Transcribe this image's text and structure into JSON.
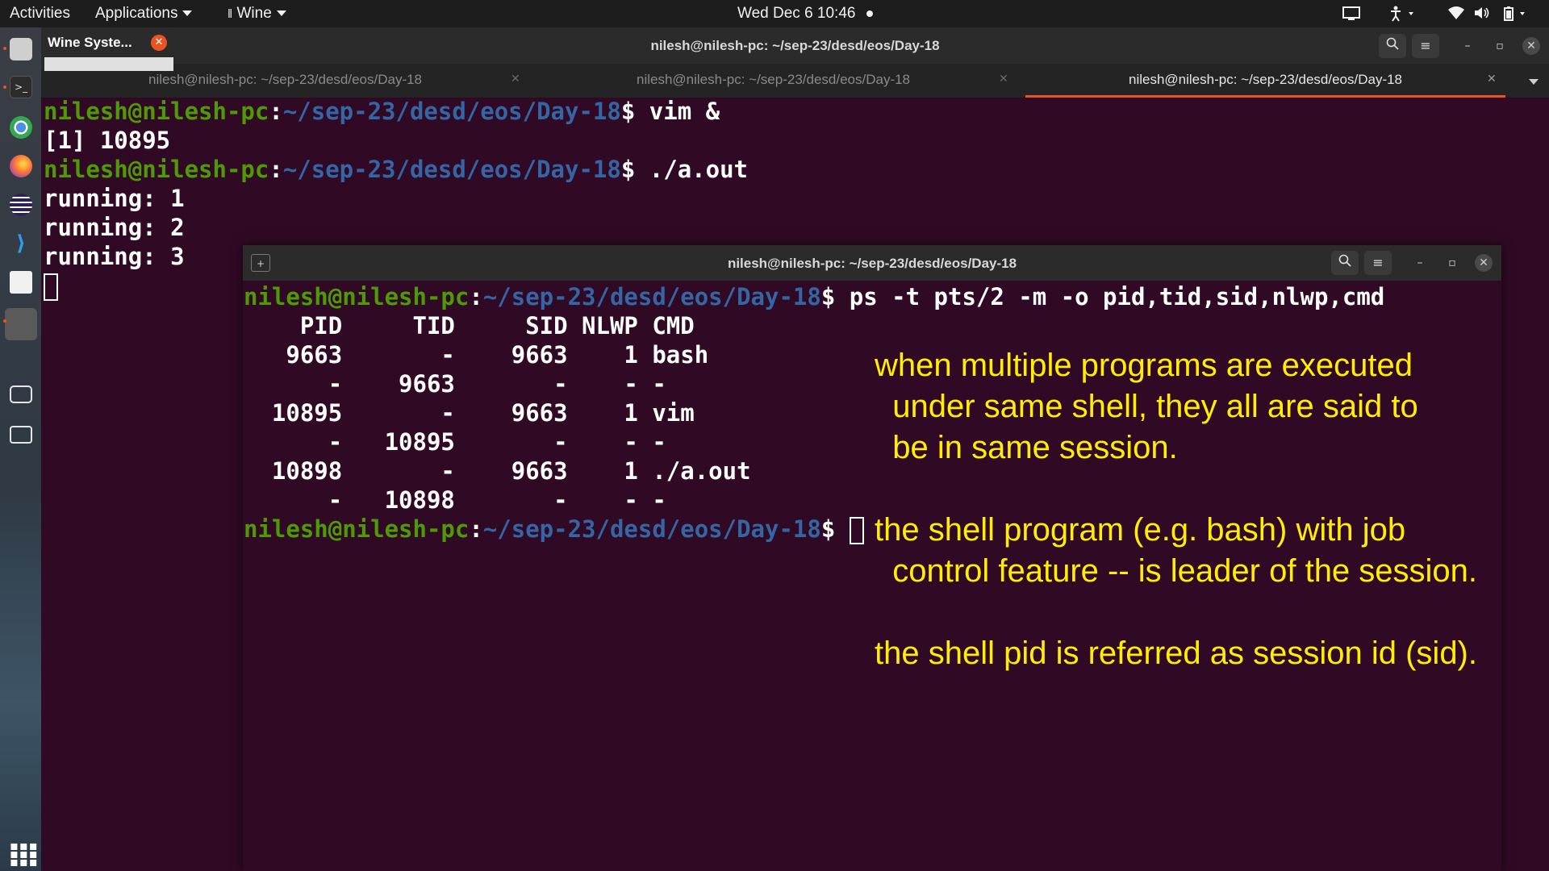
{
  "topbar": {
    "activities": "Activities",
    "applications": "Applications",
    "wine": "Wine",
    "clock": "Wed Dec 6  10:46"
  },
  "dock": {
    "icons": [
      "files-icon",
      "terminal-icon",
      "chrome-icon",
      "firefox-icon",
      "eclipse-icon",
      "vscode-icon",
      "document-viewer-icon",
      "wine-icon",
      "display-icon",
      "screenshot-icon",
      "app-grid-icon"
    ]
  },
  "wine_popup": {
    "label": "Wine Syste..."
  },
  "main_window": {
    "title": "nilesh@nilesh-pc: ~/sep-23/desd/eos/Day-18",
    "tabs": [
      "nilesh@nilesh-pc: ~/sep-23/desd/eos/Day-18",
      "nilesh@nilesh-pc: ~/sep-23/desd/eos/Day-18",
      "nilesh@nilesh-pc: ~/sep-23/desd/eos/Day-18"
    ],
    "prompt_user": "nilesh@nilesh-pc",
    "prompt_path": "~/sep-23/desd/eos/Day-18",
    "lines": {
      "cmd1": "$ vim &",
      "out1": "[1] 10895",
      "cmd2": "$ ./a.out",
      "out2": "running: 1",
      "out3": "running: 2",
      "out4": "running: 3"
    }
  },
  "sub_window": {
    "title": "nilesh@nilesh-pc: ~/sep-23/desd/eos/Day-18",
    "prompt_user": "nilesh@nilesh-pc",
    "prompt_path": "~/sep-23/desd/eos/Day-18",
    "command": "$ ps -t pts/2 -m -o pid,tid,sid,nlwp,cmd",
    "table_header": "    PID     TID     SID NLWP CMD",
    "rows": [
      "   9663       -    9663    1 bash",
      "      -    9663       -    - -",
      "  10895       -    9663    1 vim",
      "      -   10895       -    - -",
      "  10898       -    9663    1 ./a.out",
      "      -   10898       -    - -"
    ],
    "final_prompt": "$ "
  },
  "annotation": {
    "note1": "when multiple programs are executed\n  under same shell, they all are said to\n  be in same session.",
    "note2": "the shell program (e.g. bash) with job\n  control feature -- is leader of the session.",
    "note3": "the shell pid is referred as session id (sid)."
  }
}
